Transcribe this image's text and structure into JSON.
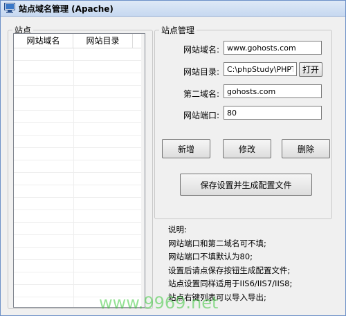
{
  "window": {
    "title": "站点域名管理 (Apache)"
  },
  "sites_group": {
    "legend": "站点",
    "columns": [
      "网站域名",
      "网站目录"
    ],
    "rows": []
  },
  "manage_group": {
    "legend": "站点管理",
    "fields": {
      "domain": {
        "label": "网站域名:",
        "value": "www.gohosts.com"
      },
      "directory": {
        "label": "网站目录:",
        "value": "C:\\phpStudy\\PHPTutorial\\WWW"
      },
      "second_domain": {
        "label": "第二域名:",
        "value": "gohosts.com"
      },
      "port": {
        "label": "网站端口:",
        "value": "80"
      }
    },
    "open_button": "打开",
    "add_button": "新增",
    "edit_button": "修改",
    "delete_button": "删除",
    "save_button": "保存设置并生成配置文件"
  },
  "notes": {
    "heading": "说明:",
    "lines": [
      "网站端口和第二域名可不填;",
      "网站端口不填默认为80;",
      "设置后请点保存按钮生成配置文件;",
      "站点设置同样适用于IIS6/IIS7/IIS8;",
      "站点右键列表可以导入导出;"
    ]
  },
  "watermark": "www.9969.net",
  "colors": {
    "title_bar": "#c6d8f0",
    "window_bg": "#f0f0f0",
    "watermark": "#3cc83c"
  }
}
